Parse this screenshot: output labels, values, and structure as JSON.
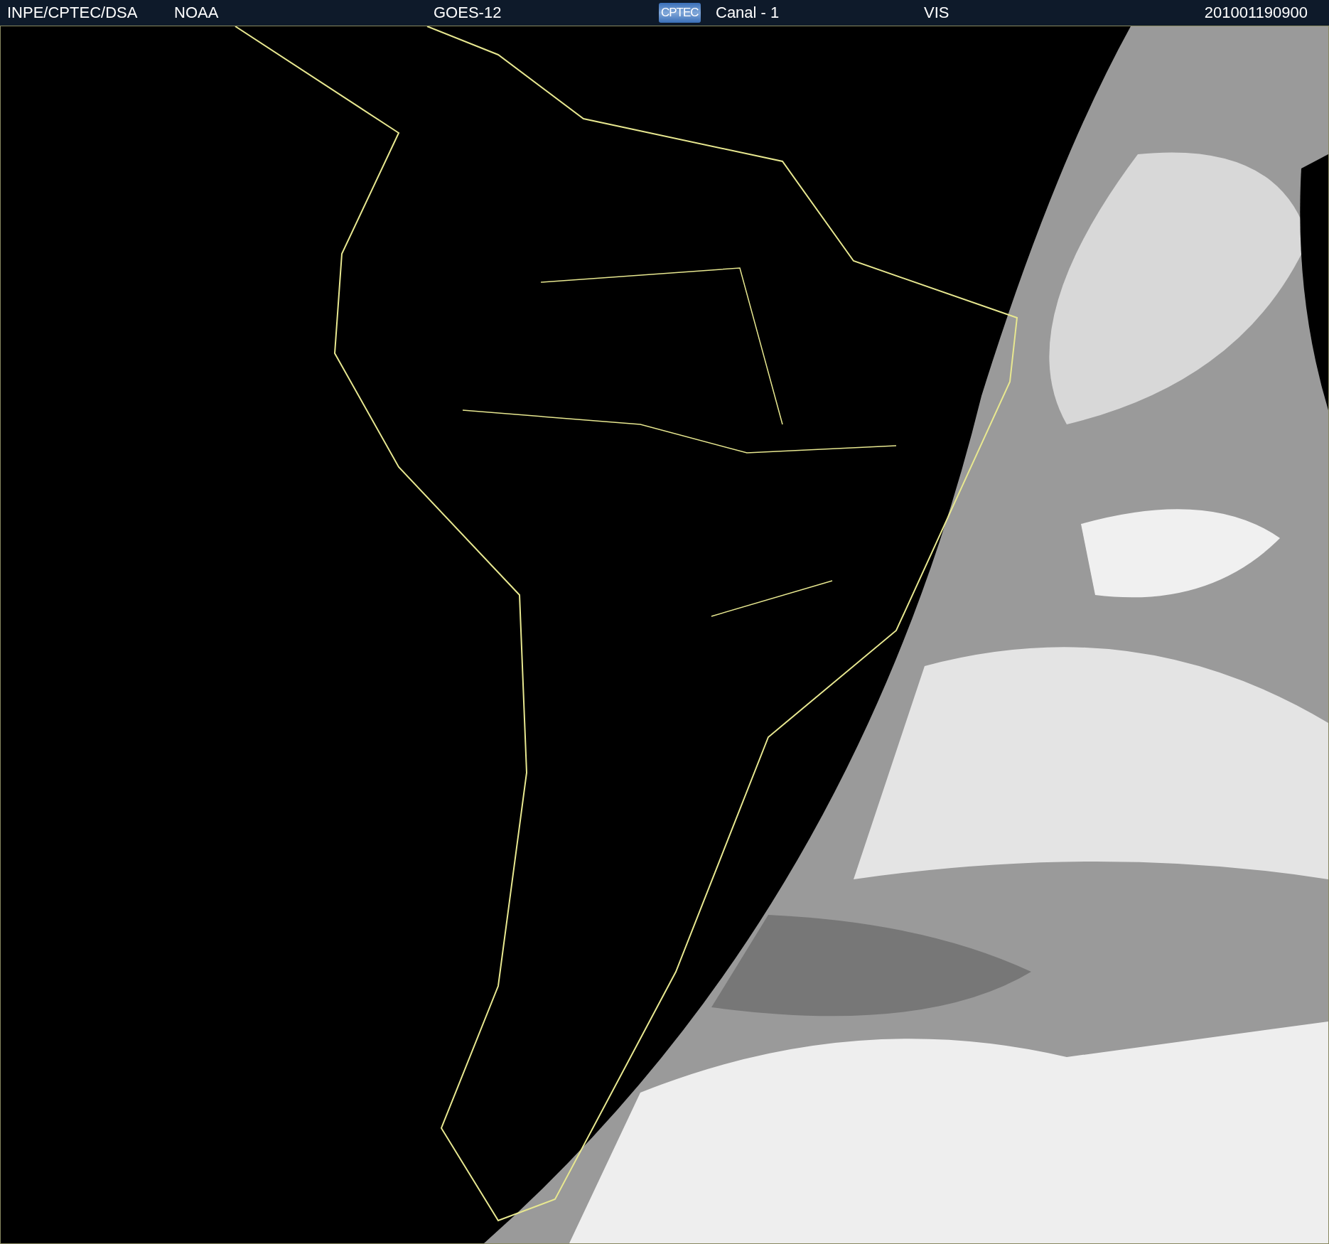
{
  "header": {
    "source": "INPE/CPTEC/DSA",
    "agency": "NOAA",
    "satellite": "GOES-12",
    "logo": "CPTEC",
    "channel": "Canal - 1",
    "band": "VIS",
    "timestamp": "201001190900"
  }
}
